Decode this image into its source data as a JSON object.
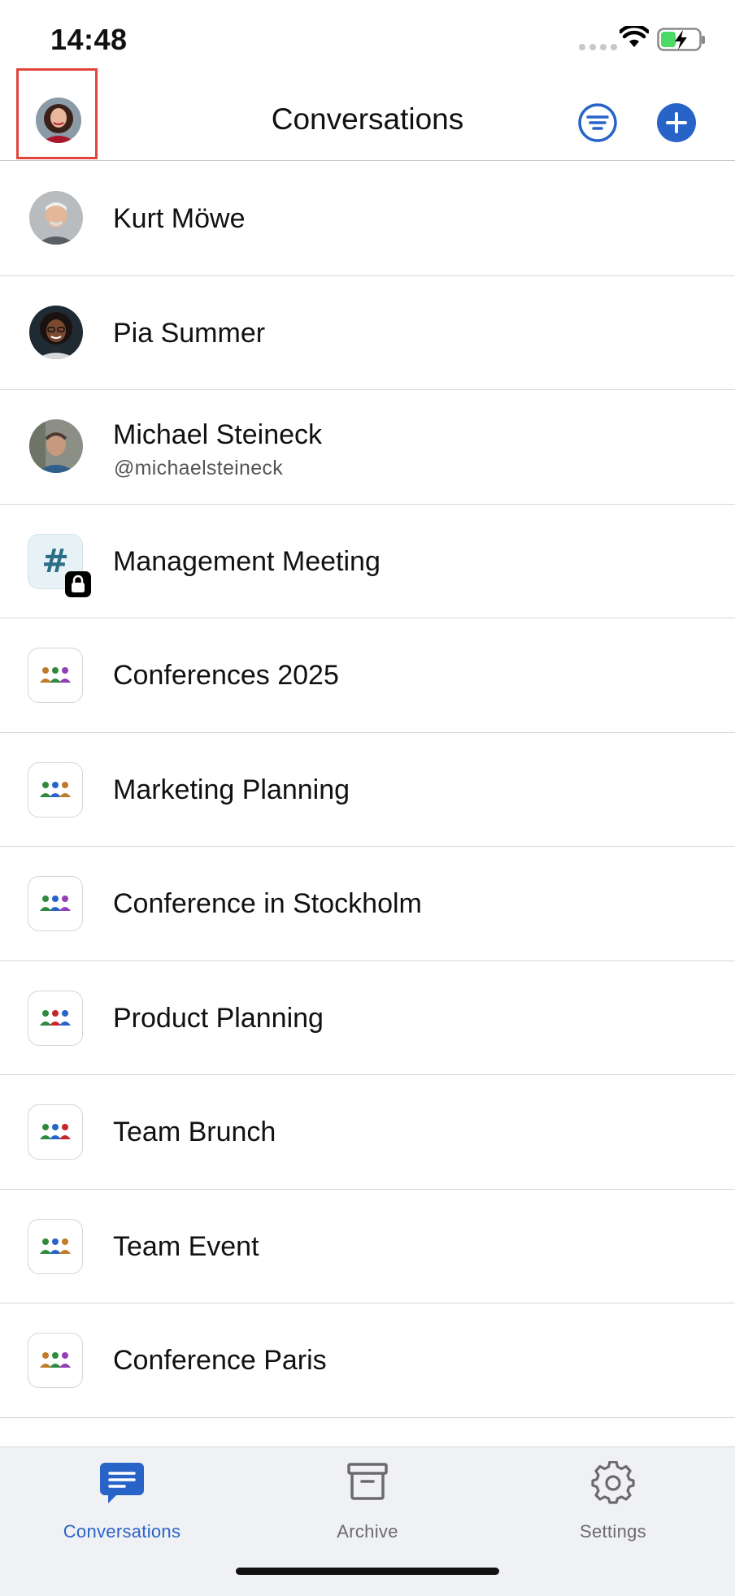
{
  "status_bar": {
    "time": "14:48"
  },
  "header": {
    "title": "Conversations"
  },
  "conversations": [
    {
      "name": "Kurt Möwe",
      "kind": "user"
    },
    {
      "name": "Pia Summer",
      "kind": "user"
    },
    {
      "name": "Michael Steineck",
      "handle": "@michaelsteineck",
      "kind": "user"
    },
    {
      "name": "Management Meeting",
      "kind": "private-channel"
    },
    {
      "name": "Conferences 2025",
      "kind": "group"
    },
    {
      "name": "Marketing Planning",
      "kind": "group"
    },
    {
      "name": "Conference in Stockholm",
      "kind": "group"
    },
    {
      "name": "Product Planning",
      "kind": "group"
    },
    {
      "name": "Team Brunch",
      "kind": "group"
    },
    {
      "name": "Team Event",
      "kind": "group"
    },
    {
      "name": "Conference Paris",
      "kind": "group"
    }
  ],
  "tabs": [
    {
      "label": "Conversations",
      "icon": "chat-bubble-icon",
      "active": true
    },
    {
      "label": "Archive",
      "icon": "archive-box-icon",
      "active": false
    },
    {
      "label": "Settings",
      "icon": "gear-icon",
      "active": false
    }
  ],
  "colors": {
    "accent": "#2864c8",
    "inactive": "#6b6b6b",
    "highlight": "#e0443a"
  }
}
